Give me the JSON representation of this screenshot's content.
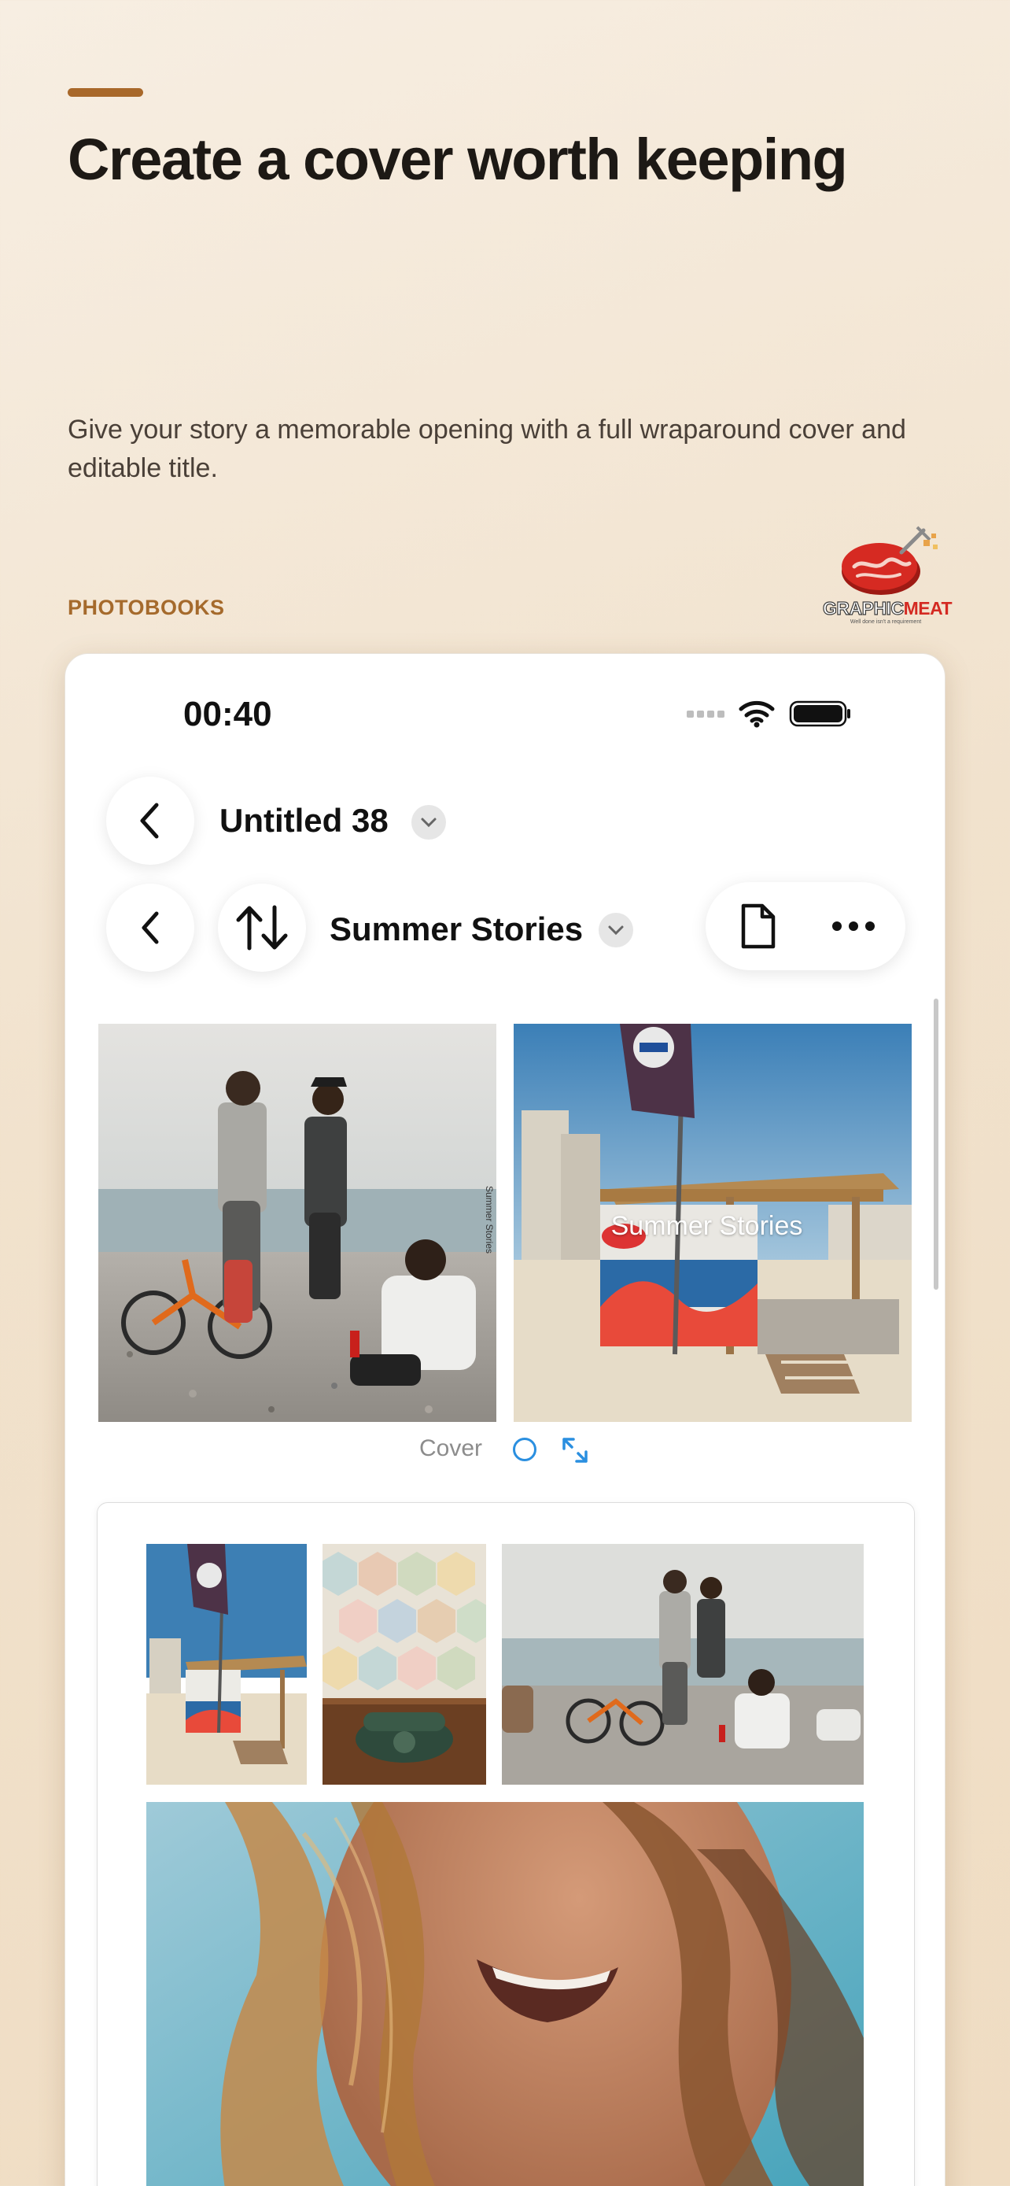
{
  "header": {
    "headline": "Create a cover worth keeping",
    "subtitle": "Give your story a memorable opening with a full wraparound cover and editable title.",
    "section_label": "PHOTOBOOKS"
  },
  "brand": {
    "logo_word_white": "GRAPHIC",
    "logo_word_red": "MEAT",
    "logo_tagline": "Well done isn't a requirement",
    "icon": "steak-logo"
  },
  "status_bar": {
    "time": "00:40",
    "icons": [
      "cellular-signal-icon",
      "wifi-icon",
      "battery-icon"
    ]
  },
  "nav": {
    "project_title": "Untitled 38",
    "album_title": "Summer Stories",
    "icons": [
      "back-chevron-icon",
      "reorder-arrows-icon",
      "chevron-down-icon",
      "document-icon",
      "more-icon"
    ]
  },
  "cover": {
    "spine_text": "Summer Stories",
    "front_title": "Summer Stories",
    "label": "Cover",
    "images": [
      "friends-on-pebble-beach-photo",
      "beach-hut-with-flag-photo"
    ]
  },
  "page": {
    "images": [
      "beach-hut-thumbnail",
      "green-telephone-photo",
      "friends-on-beach-wide-photo",
      "smiling-woman-hair-photo"
    ]
  },
  "colors": {
    "accent": "#a8682a",
    "label": "#a56a2c",
    "headline": "#1d1915",
    "selection_blue": "#2a8fe0",
    "brand_red": "#d42a22"
  }
}
